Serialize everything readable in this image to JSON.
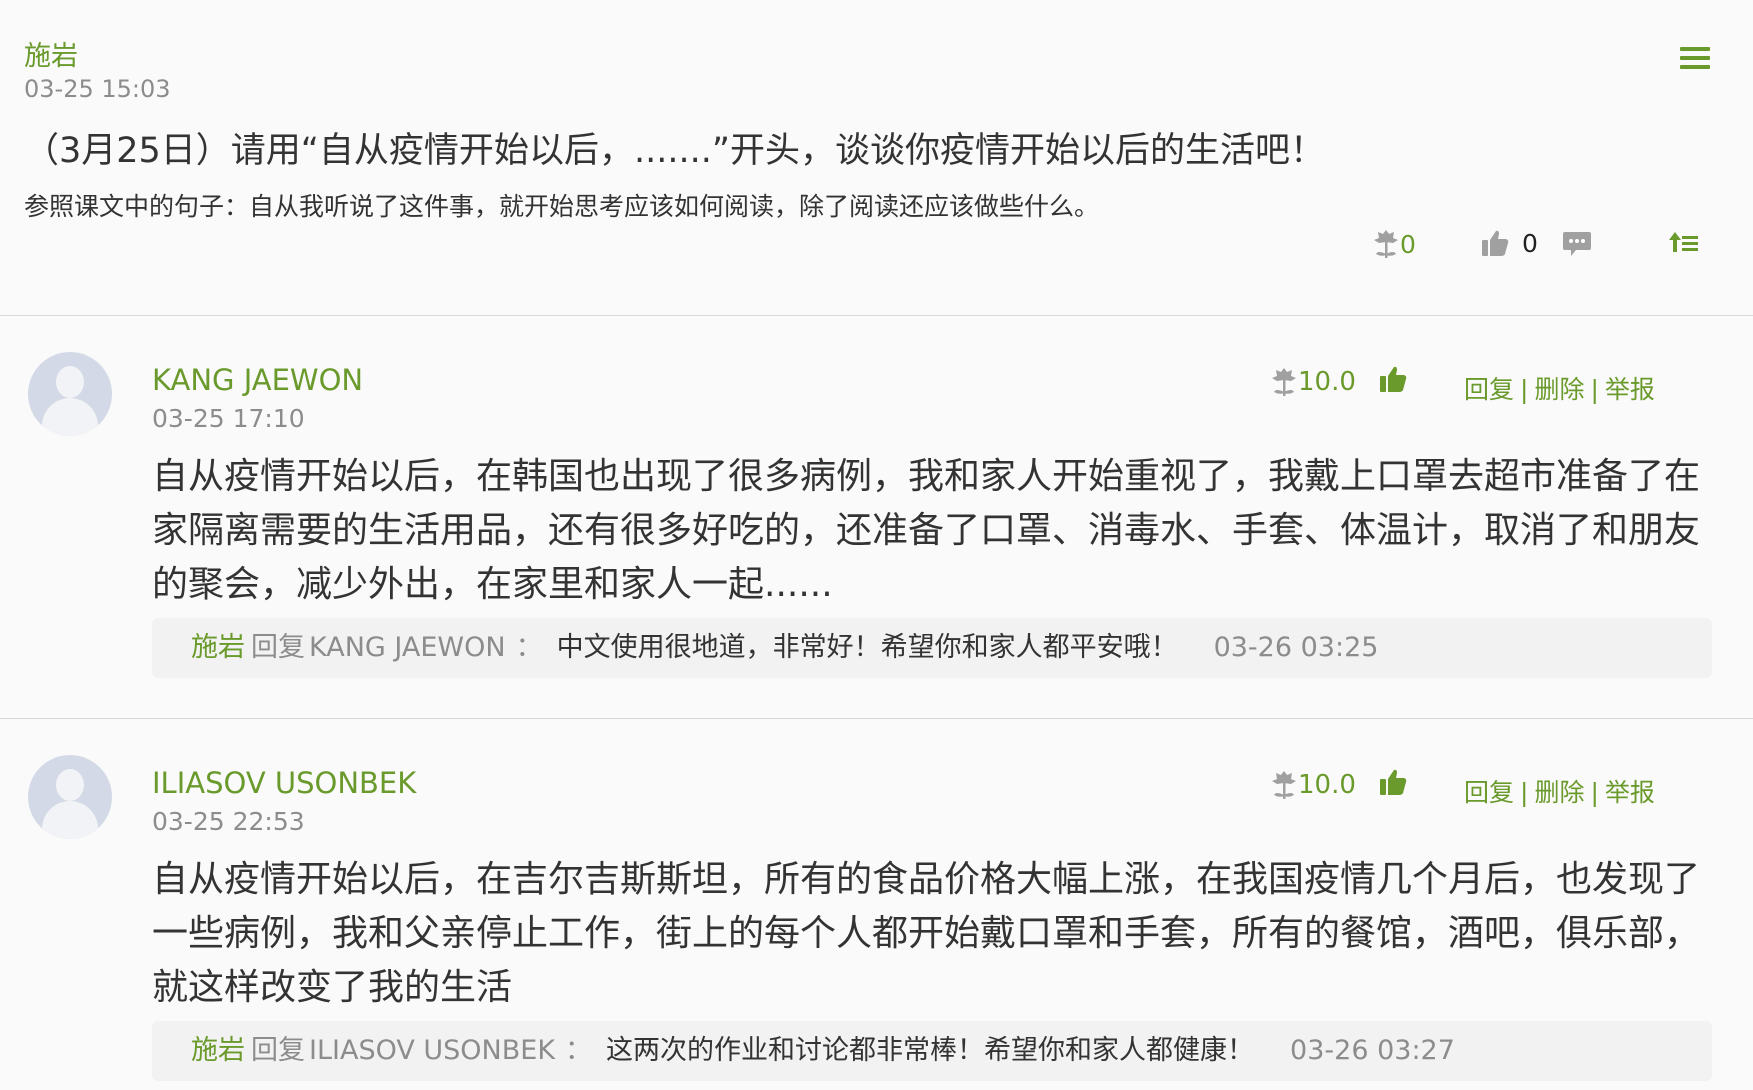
{
  "post": {
    "author": "施岩",
    "date": "03-25 15:03",
    "title": "（3月25日）请用“自从疫情开始以后，.......”开头，谈谈你疫情开始以后的生活吧！",
    "description": "参照课文中的句子：自从我听说了这件事，就开始思考应该如何阅读，除了阅读还应该做些什么。",
    "flower_count": "0",
    "like_count": "0"
  },
  "comments": [
    {
      "name": "KANG JAEWON",
      "date": "03-25 17:10",
      "score": "10.0",
      "reply_label": "回复",
      "delete_label": "删除",
      "report_label": "举报",
      "sep": "|",
      "text": "自从疫情开始以后，在韩国也出现了很多病例，我和家人开始重视了，我戴上口罩去超市准备了在家隔离需要的生活用品，还有很多好吃的，还准备了口罩、消毒水、手套、体温计，取消了和朋友的聚会，减少外出，在家里和家人一起......",
      "reply": {
        "author": "施岩",
        "verb": "回复",
        "target": "KANG JAEWON",
        "colon": "：",
        "text": "中文使用很地道，非常好！希望你和家人都平安哦！",
        "date": "03-26 03:25"
      }
    },
    {
      "name": "ILIASOV USONBEK",
      "date": "03-25 22:53",
      "score": "10.0",
      "reply_label": "回复",
      "delete_label": "删除",
      "report_label": "举报",
      "sep": "|",
      "text": "自从疫情开始以后，在吉尔吉斯斯坦，所有的食品价格大幅上涨，在我国疫情几个月后，也发现了一些病例，我和父亲停止工作，街上的每个人都开始戴口罩和手套，所有的餐馆，酒吧，俱乐部，就这样改变了我的生活",
      "reply": {
        "author": "施岩",
        "verb": "回复",
        "target": "ILIASOV USONBEK",
        "colon": "：",
        "text": "这两次的作业和讨论都非常棒！希望你和家人都健康！",
        "date": "03-26 03:27"
      }
    }
  ],
  "icons": {
    "menu": "hamburger-menu-icon",
    "flower": "flower-icon",
    "like": "thumbs-up-icon",
    "comment": "comment-bubble-icon",
    "top": "pin-to-top-icon",
    "avatar": "default-avatar-icon"
  },
  "colors": {
    "accent": "#6a9a2c",
    "muted": "#8c8c8c",
    "text": "#333333",
    "icon_gray": "#a0a0a0"
  }
}
